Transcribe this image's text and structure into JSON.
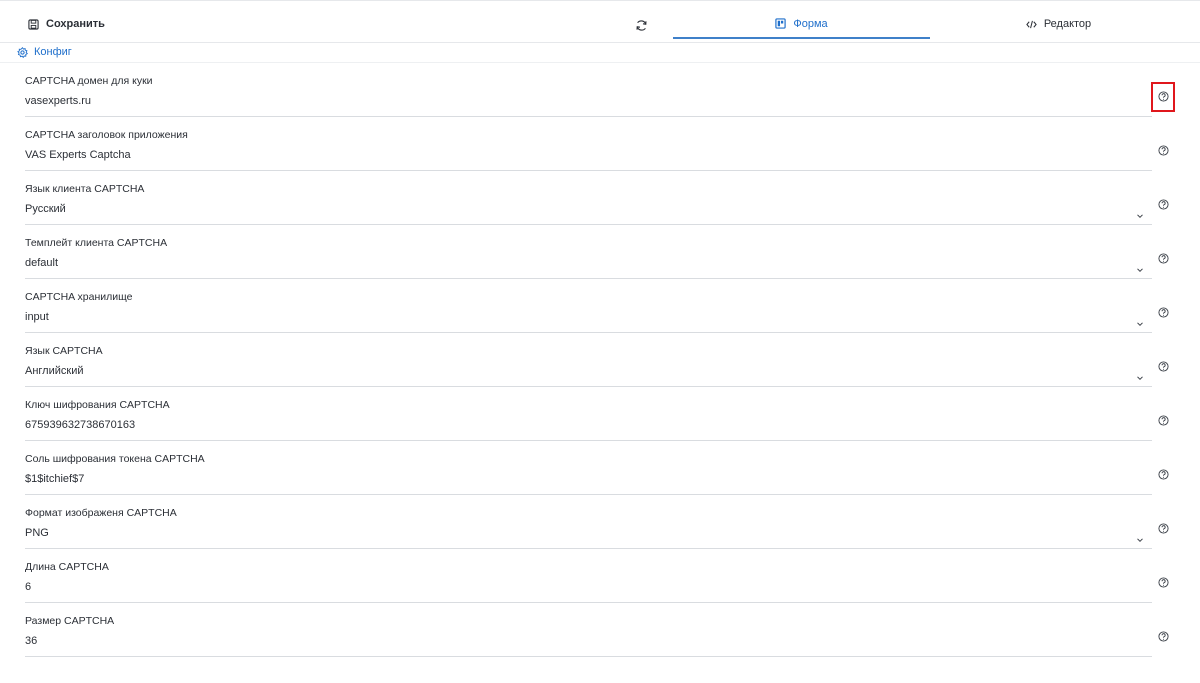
{
  "toolbar": {
    "save_label": "Сохранить",
    "tabs": [
      {
        "label": "Форма",
        "active": true
      },
      {
        "label": "Редактор",
        "active": false
      }
    ]
  },
  "config_link": "Конфиг",
  "colors": {
    "accent": "#1f6fcb",
    "highlight": "#e0171c"
  },
  "fields": [
    {
      "label": "CAPTCHA домен для куки",
      "value": "vasexperts.ru",
      "type": "text"
    },
    {
      "label": "CAPTCHA заголовок приложения",
      "value": "VAS Experts Captcha",
      "type": "text"
    },
    {
      "label": "Язык клиента CAPTCHA",
      "value": "Русский",
      "type": "select"
    },
    {
      "label": "Темплейт клиента CAPTCHA",
      "value": "default",
      "type": "select"
    },
    {
      "label": "CAPTCHA хранилище",
      "value": "input",
      "type": "select"
    },
    {
      "label": "Язык CAPTCHA",
      "value": "Английский",
      "type": "select"
    },
    {
      "label": "Ключ шифрования CAPTCHA",
      "value": "675939632738670163",
      "type": "text"
    },
    {
      "label": "Соль шифрования токена CAPTCHA",
      "value": "$1$itchief$7",
      "type": "text"
    },
    {
      "label": "Формат изображеня CAPTCHA",
      "value": "PNG",
      "type": "select"
    },
    {
      "label": "Длина CAPTCHA",
      "value": "6",
      "type": "text"
    },
    {
      "label": "Размер CAPTCHA",
      "value": "36",
      "type": "text"
    }
  ]
}
